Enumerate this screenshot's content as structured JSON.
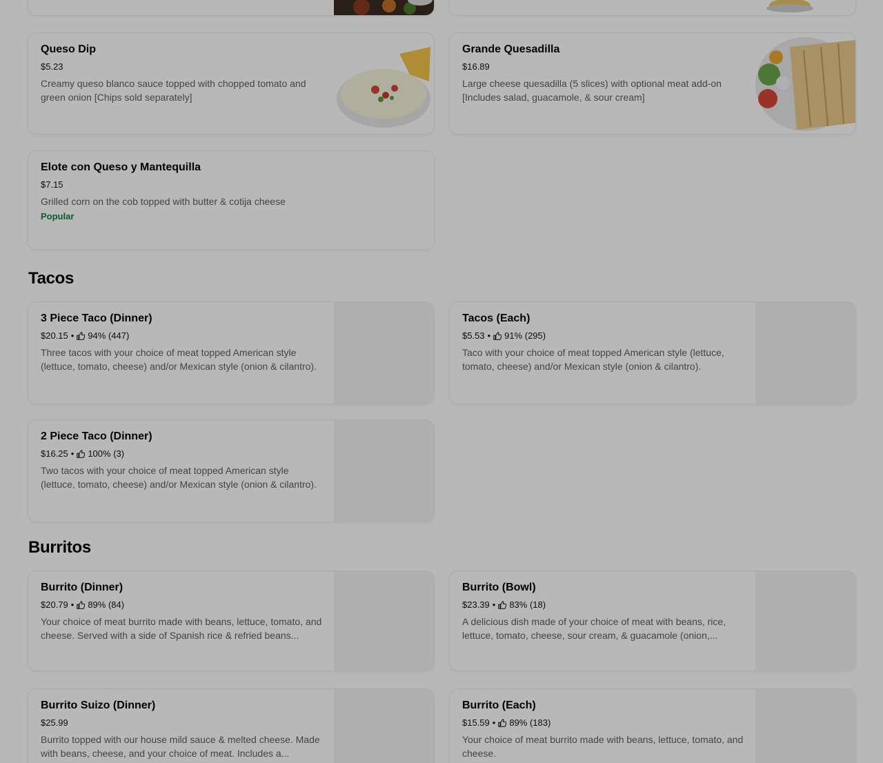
{
  "sections": {
    "tacos_title": "Tacos",
    "burritos_title": "Burritos"
  },
  "items": {
    "queso_dip": {
      "name": "Queso Dip",
      "price": "$5.23",
      "description": "Creamy queso blanco sauce topped with chopped tomato and green onion [Chips sold separately]"
    },
    "grande_quesadilla": {
      "name": "Grande Quesadilla",
      "price": "$16.89",
      "description": "Large cheese quesadilla (5 slices) with optional meat add-on [Includes salad, guacamole, & sour cream]"
    },
    "elote": {
      "name": "Elote con Queso y Mantequilla",
      "price": "$7.15",
      "description": "Grilled corn on the cob topped with butter & cotija cheese",
      "badge": "Popular"
    },
    "three_piece_taco": {
      "name": "3 Piece Taco (Dinner)",
      "price": "$20.15",
      "rating": "94% (447)",
      "description": "Three tacos with your choice of meat topped American style (lettuce, tomato, cheese) and/or Mexican style (onion & cilantro)."
    },
    "tacos_each": {
      "name": "Tacos (Each)",
      "price": "$5.53",
      "rating": "91% (295)",
      "description": "Taco with your choice of meat topped American style (lettuce, tomato, cheese) and/or Mexican style (onion & cilantro)."
    },
    "two_piece_taco": {
      "name": "2 Piece Taco (Dinner)",
      "price": "$16.25",
      "rating": "100% (3)",
      "description": "Two tacos with your choice of meat topped American style (lettuce, tomato, cheese) and/or Mexican style (onion & cilantro)."
    },
    "burrito_dinner": {
      "name": "Burrito (Dinner)",
      "price": "$20.79",
      "rating": "89% (84)",
      "description": "Your choice of meat burrito made with beans, lettuce, tomato, and cheese. Served with a side of Spanish rice & refried beans..."
    },
    "burrito_bowl": {
      "name": "Burrito (Bowl)",
      "price": "$23.39",
      "rating": "83% (18)",
      "description": "A delicious dish made of your choice of meat with beans, rice, lettuce, tomato, cheese, sour cream, & guacamole (onion,..."
    },
    "burrito_suizo": {
      "name": "Burrito Suizo (Dinner)",
      "price": "$25.99",
      "description": "Burrito topped with our house mild sauce & melted cheese. Made with beans, cheese, and your choice of meat. Includes a..."
    },
    "burrito_each": {
      "name": "Burrito (Each)",
      "price": "$15.59",
      "rating": "89% (183)",
      "description": "Your choice of meat burrito made with beans, lettuce, tomato, and cheese."
    }
  },
  "separator": "•",
  "colors": {
    "overlay": "rgba(0,0,0,0.28)",
    "popular_badge": "#0e8345",
    "description_text": "#5e5e5e"
  }
}
